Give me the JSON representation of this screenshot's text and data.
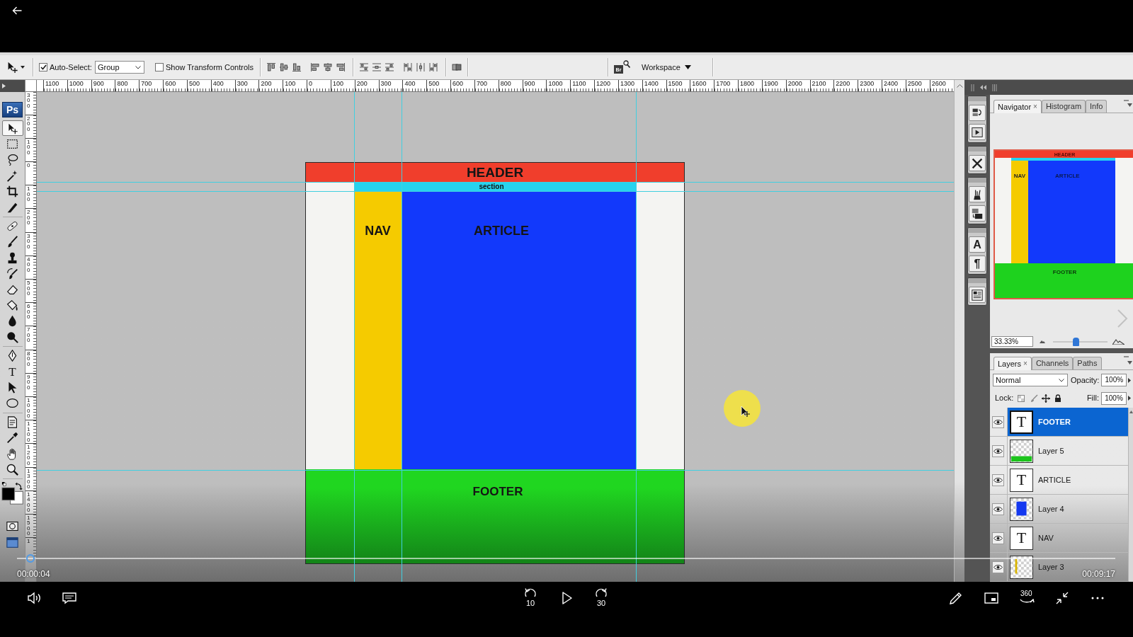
{
  "player": {
    "elapsed": "00:00:04",
    "duration": "00:09:17",
    "progress": {
      "level": 0.012
    },
    "controls": [
      {
        "kind": "volume"
      },
      {
        "kind": "captions"
      },
      {
        "kind": "rewind",
        "label": "10"
      },
      {
        "kind": "play"
      },
      {
        "kind": "forward",
        "label": "30"
      },
      {
        "kind": "pen"
      },
      {
        "kind": "miniview"
      },
      {
        "kind": "vr",
        "label": "360"
      },
      {
        "kind": "shrink"
      },
      {
        "kind": "more"
      }
    ]
  },
  "options_bar": {
    "auto_select": {
      "label": "Auto-Select:",
      "checked": true
    },
    "auto_select_target": "Group",
    "transform_controls": {
      "label": "Show Transform Controls",
      "checked": false
    },
    "bridge": "Br",
    "workspace": "Workspace"
  },
  "toolbox": {
    "logo": "Ps",
    "groups": [
      {
        "tools": [
          {
            "kind": "move",
            "selected": true
          },
          {
            "kind": "marquee",
            "selected": false
          },
          {
            "kind": "lasso",
            "selected": false
          },
          {
            "kind": "wand",
            "selected": false
          },
          {
            "kind": "crop",
            "selected": false
          },
          {
            "kind": "slice",
            "selected": false
          }
        ]
      },
      {
        "tools": [
          {
            "kind": "heal",
            "selected": false
          },
          {
            "kind": "brush",
            "selected": false
          },
          {
            "kind": "stamp",
            "selected": false
          },
          {
            "kind": "historybrush",
            "selected": false
          },
          {
            "kind": "eraser",
            "selected": false
          },
          {
            "kind": "bucket",
            "selected": false
          },
          {
            "kind": "blur",
            "selected": false
          },
          {
            "kind": "dodge",
            "selected": false
          }
        ]
      },
      {
        "tools": [
          {
            "kind": "pen",
            "selected": false
          },
          {
            "kind": "type",
            "glyph": "T",
            "selected": false
          },
          {
            "kind": "path",
            "selected": false
          },
          {
            "kind": "ellipse",
            "selected": false
          }
        ]
      },
      {
        "tools": [
          {
            "kind": "notes",
            "selected": false
          },
          {
            "kind": "eyedropper",
            "selected": false
          },
          {
            "kind": "hand",
            "selected": false
          },
          {
            "kind": "zoom",
            "selected": false
          }
        ]
      },
      {
        "tools": [
          {
            "kind": "colors",
            "selected": false
          },
          {
            "kind": "mask",
            "selected": false
          },
          {
            "kind": "screen",
            "selected": false
          }
        ]
      }
    ]
  },
  "rulers": {
    "horizontal": [
      "1100",
      "1000",
      "900",
      "800",
      "700",
      "600",
      "500",
      "400",
      "300",
      "200",
      "100",
      "0",
      "100",
      "200",
      "300",
      "400",
      "500",
      "600",
      "700",
      "800",
      "900",
      "1000",
      "1100",
      "1200",
      "1300",
      "1400",
      "1500",
      "1600",
      "1700",
      "1800",
      "1900",
      "2000",
      "2100",
      "2200",
      "2300",
      "2400",
      "2500",
      "2600"
    ],
    "vertical": [
      "300",
      "200",
      "100",
      "0",
      "100",
      "200",
      "300",
      "400",
      "500",
      "600",
      "700",
      "800",
      "900",
      "1000",
      "1100",
      "1200",
      "1300",
      "1400",
      "1500",
      "1"
    ]
  },
  "document": {
    "header": "HEADER",
    "section": "section",
    "nav": "NAV",
    "article": "ARTICLE",
    "footer": "FOOTER"
  },
  "dock": [
    {
      "items": [
        {
          "kind": "history"
        },
        {
          "kind": "actions"
        }
      ]
    },
    {
      "items": [
        {
          "kind": "tools"
        }
      ]
    },
    {
      "items": [
        {
          "kind": "brushes"
        },
        {
          "kind": "clone"
        }
      ]
    },
    {
      "items": [
        {
          "kind": "character",
          "glyph": "A"
        },
        {
          "kind": "paragraph",
          "glyph": "¶"
        }
      ]
    },
    {
      "items": [
        {
          "kind": "comps"
        }
      ]
    }
  ],
  "navigator": {
    "tabs": [
      {
        "label": "Navigator",
        "close": "×",
        "selected": true
      },
      {
        "label": "Histogram",
        "selected": false
      },
      {
        "label": "Info",
        "selected": false
      }
    ],
    "preview": {
      "header": "HEADER",
      "nav": "NAV",
      "article": "ARTICLE",
      "footer": "FOOTER"
    },
    "zoom": "33.33%",
    "zoom_slider": {
      "level": 0.42
    }
  },
  "layers": {
    "tabs": [
      {
        "label": "Layers",
        "close": "×",
        "selected": true
      },
      {
        "label": "Channels",
        "selected": false
      },
      {
        "label": "Paths",
        "selected": false
      }
    ],
    "blend_mode": "Normal",
    "opacity_label": "Opacity:",
    "opacity": "100%",
    "lock_label": "Lock:",
    "fill_label": "Fill:",
    "fill": "100%",
    "items": [
      {
        "name": "FOOTER",
        "kind": "type",
        "glyph": "T",
        "visible": true,
        "selected": true
      },
      {
        "name": "Layer 5",
        "kind": "band",
        "color": "#1cc41c",
        "visible": true,
        "selected": false
      },
      {
        "name": "ARTICLE",
        "kind": "type",
        "glyph": "T",
        "visible": true,
        "selected": false
      },
      {
        "name": "Layer 4",
        "kind": "block",
        "color": "#1438f0",
        "visible": true,
        "selected": false
      },
      {
        "name": "NAV",
        "kind": "type",
        "glyph": "T",
        "visible": true,
        "selected": false
      },
      {
        "name": "Layer 3",
        "kind": "strip",
        "color": "#d9b400",
        "visible": true,
        "selected": false
      }
    ]
  }
}
